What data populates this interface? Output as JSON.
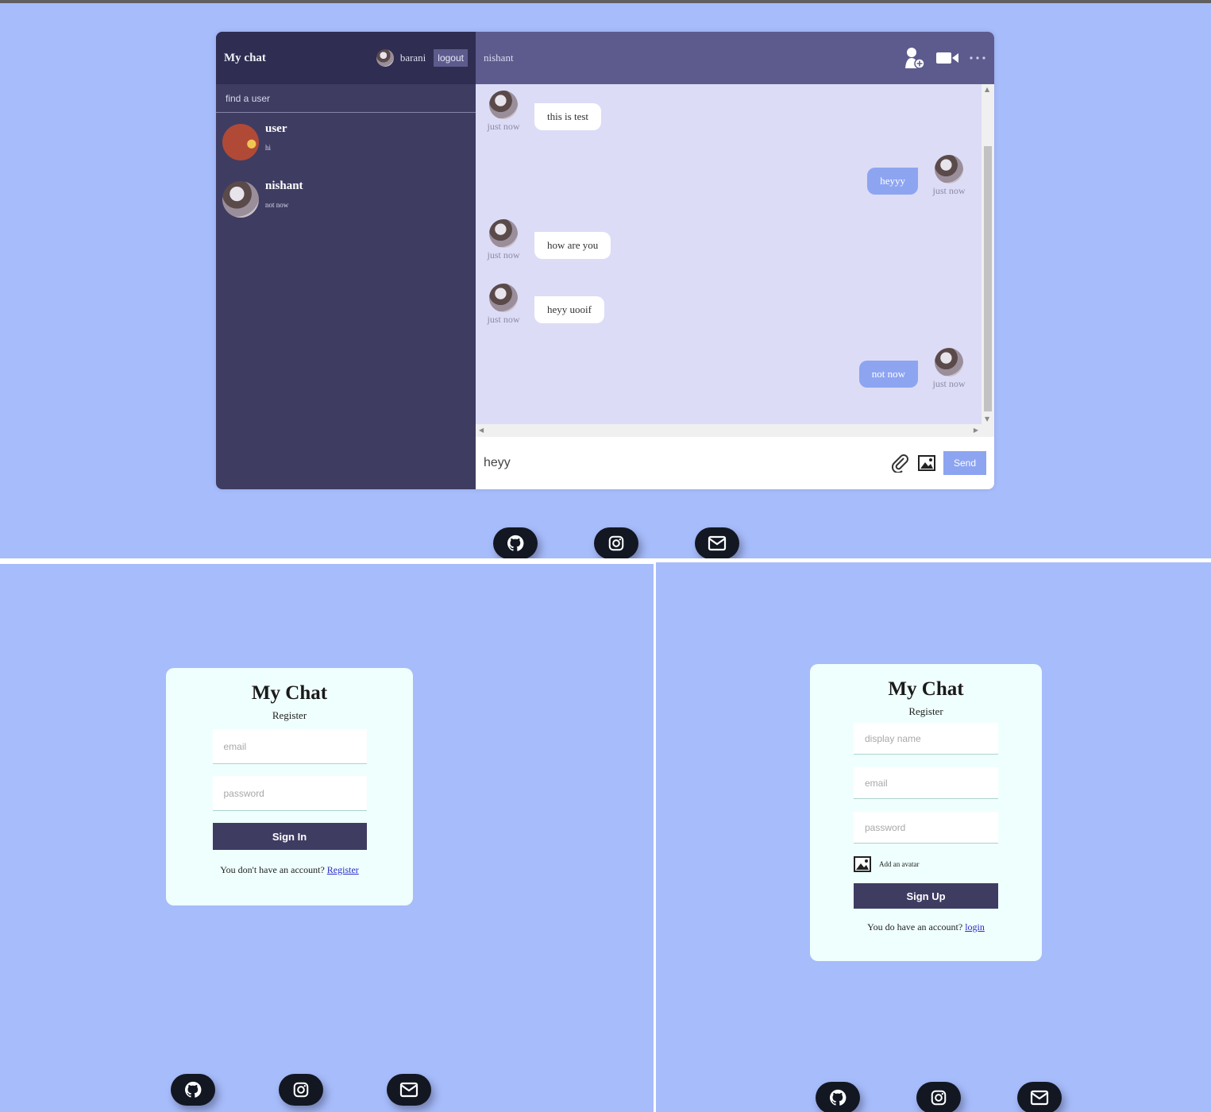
{
  "chat_app": {
    "logo": "My chat",
    "current_user": "barani",
    "logout_label": "logout",
    "search_placeholder": "find a user",
    "chats": [
      {
        "name": "user",
        "last_message": "hi"
      },
      {
        "name": "nishant",
        "last_message": "not now"
      }
    ],
    "active_chat_name": "nishant",
    "messages": [
      {
        "text": "this is test",
        "time": "just now",
        "owner": false
      },
      {
        "text": "heyyy",
        "time": "just now",
        "owner": true
      },
      {
        "text": "how are you",
        "time": "just now",
        "owner": false
      },
      {
        "text": "heyy uooif",
        "time": "just now",
        "owner": false
      },
      {
        "text": "not now",
        "time": "just now",
        "owner": true
      }
    ],
    "input_value": "heyy",
    "send_label": "Send",
    "icons": [
      "add-user-icon",
      "video-camera-icon",
      "more-icon",
      "attach-icon",
      "image-icon"
    ]
  },
  "socials": [
    "github-icon",
    "instagram-icon",
    "mail-icon"
  ],
  "login_form": {
    "logo": "My Chat",
    "title": "Register",
    "email_placeholder": "email",
    "password_placeholder": "password",
    "button_label": "Sign In",
    "footer_text": "You don't have an account?",
    "footer_link": "Register"
  },
  "register_form": {
    "logo": "My Chat",
    "title": "Register",
    "display_name_placeholder": "display name",
    "email_placeholder": "email",
    "password_placeholder": "password",
    "avatar_label": "Add an avatar",
    "button_label": "Sign Up",
    "footer_text": "You do have an account?",
    "footer_link": "login"
  },
  "colors": {
    "background": "#a7bcfb",
    "sidebar": "#3f3c62",
    "navbar": "#2f2d51",
    "chat_header": "#5d5b8d",
    "messages_bg": "#dcdcf6",
    "owner_bubble": "#8da4f1",
    "form_card": "#effffd",
    "form_button": "#3f3c62"
  }
}
